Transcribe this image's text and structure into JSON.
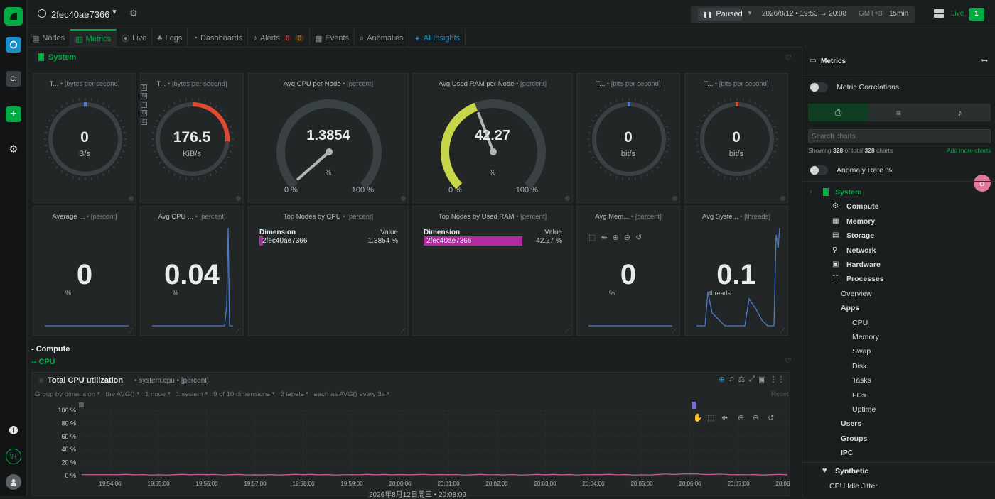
{
  "rail": {
    "logo": "leaf-logo",
    "items": [
      "chat-icon",
      "space-icon",
      "plus-icon",
      "gear-icon"
    ],
    "bottom": [
      "info-icon",
      "9+",
      "avatar"
    ],
    "space_label": "C:"
  },
  "topbar": {
    "node_name": "2fec40ae7366",
    "state": "Paused",
    "time_range": "2026/8/12 • 19:53 → 20:08",
    "tz": "GMT+8",
    "duration": "15min",
    "live_label": "Live",
    "live_count": "1"
  },
  "tabs": [
    {
      "label": "Nodes",
      "icon": "nodes-icon"
    },
    {
      "label": "Metrics",
      "icon": "metrics-icon",
      "active": true
    },
    {
      "label": "Live",
      "icon": "live-icon"
    },
    {
      "label": "Logs",
      "icon": "logs-icon"
    },
    {
      "label": "Dashboards",
      "icon": "dashboards-icon"
    },
    {
      "label": "Alerts",
      "icon": "alerts-icon",
      "badges": [
        "0",
        "0"
      ]
    },
    {
      "label": "Events",
      "icon": "events-icon"
    },
    {
      "label": "Anomalies",
      "icon": "anomalies-icon"
    },
    {
      "label": "AI Insights",
      "icon": "ai-icon"
    }
  ],
  "section": {
    "title": "System",
    "compute": "- Compute",
    "cpu": "-- CPU"
  },
  "gauges": [
    {
      "title": "T...",
      "unit": "• [bytes per second]",
      "value": "0",
      "units_label": "B/s"
    },
    {
      "title": "T...",
      "unit": "• [bytes per second]",
      "value": "176.5",
      "units_label": "KiB/s"
    },
    {
      "title": "Avg CPU per Node",
      "unit": "• [percent]",
      "value": "1.3854",
      "units_label": "%",
      "min": "0 %",
      "max": "100 %"
    },
    {
      "title": "Avg Used RAM per Node",
      "unit": "• [percent]",
      "value": "42.27",
      "units_label": "%",
      "min": "0 %",
      "max": "100 %"
    },
    {
      "title": "T...",
      "unit": "• [bits per second]",
      "value": "0",
      "units_label": "bit/s"
    },
    {
      "title": "T...",
      "unit": "• [bits per second]",
      "value": "0",
      "units_label": "bit/s"
    }
  ],
  "gauge_side_letters": [
    "Σ",
    "N",
    "T",
    "D",
    "E"
  ],
  "row2": [
    {
      "title": "Average ...",
      "unit": "• [percent]",
      "value": "0",
      "units_label": "%"
    },
    {
      "title": "Avg CPU ...",
      "unit": "• [percent]",
      "value": "0.04",
      "units_label": "%"
    },
    {
      "title": "Top Nodes by CPU",
      "unit": "• [percent]",
      "col1": "Dimension",
      "col2": "Value",
      "node": "2fec40ae7366",
      "value": "1.3854",
      "value_unit": "%"
    },
    {
      "title": "Top Nodes by Used RAM",
      "unit": "• [percent]",
      "col1": "Dimension",
      "col2": "Value",
      "node": "2fec40ae7366",
      "value": "42.27",
      "value_unit": "%"
    },
    {
      "title": "Avg Mem...",
      "unit": "• [percent]",
      "value": "0",
      "units_label": "%"
    },
    {
      "title": "Avg Syste...",
      "unit": "• [threads]",
      "value": "0.1",
      "units_label": "threads"
    }
  ],
  "cpu_chart": {
    "title": "Total CPU utilization",
    "context": "• system.cpu • [percent]",
    "controls": [
      "Group by dimension",
      "the AVG()",
      "1 node",
      "1 system",
      "9 of 10 dimensions",
      "2 labels",
      "each as AVG() every 3s"
    ],
    "reset": "Reset",
    "timestamp": "2026年8月12日周三 • 20:08:09"
  },
  "chart_data": {
    "type": "line",
    "title": "Total CPU utilization",
    "ylabel": "",
    "ylim": [
      0,
      100
    ],
    "y_ticks": [
      "100 %",
      "80 %",
      "60 %",
      "40 %",
      "20 %",
      "0 %"
    ],
    "categories": [
      "19:54:00",
      "19:55:00",
      "19:56:00",
      "19:57:00",
      "19:58:00",
      "19:59:00",
      "20:00:00",
      "20:01:00",
      "20:02:00",
      "20:03:00",
      "20:04:00",
      "20:05:00",
      "20:06:00",
      "20:07:00",
      "20:08:00"
    ],
    "series": [
      {
        "values": [
          1.4,
          1.3,
          1.5,
          1.2,
          1.4,
          1.3,
          1.6,
          1.3,
          1.4,
          1.2,
          1.5,
          1.3,
          2.4,
          1.4,
          1.3
        ]
      }
    ]
  },
  "sidebar": {
    "title": "Metrics",
    "correlations": "Metric Correlations",
    "search_placeholder": "Search charts",
    "showing_pre": "Showing",
    "showing_n": "328",
    "showing_mid": "of total",
    "showing_total": "328",
    "showing_post": "charts",
    "add_more": "Add more charts",
    "anomaly": "Anomaly Rate %",
    "tree": [
      {
        "label": "System",
        "level": 0,
        "bold": true,
        "green": true
      },
      {
        "label": "Compute",
        "level": 1,
        "bold": true,
        "icon": "cpu-icon"
      },
      {
        "label": "Memory",
        "level": 1,
        "bold": true,
        "icon": "memory-icon"
      },
      {
        "label": "Storage",
        "level": 1,
        "bold": true,
        "icon": "storage-icon"
      },
      {
        "label": "Network",
        "level": 1,
        "bold": true,
        "icon": "network-icon"
      },
      {
        "label": "Hardware",
        "level": 1,
        "bold": true,
        "icon": "hardware-icon"
      },
      {
        "label": "Processes",
        "level": 1,
        "bold": true,
        "icon": "processes-icon"
      },
      {
        "label": "Overview",
        "level": 2
      },
      {
        "label": "Apps",
        "level": 2,
        "bold": true
      },
      {
        "label": "CPU",
        "level": 3
      },
      {
        "label": "Memory",
        "level": 3
      },
      {
        "label": "Swap",
        "level": 3
      },
      {
        "label": "Disk",
        "level": 3
      },
      {
        "label": "Tasks",
        "level": 3
      },
      {
        "label": "FDs",
        "level": 3
      },
      {
        "label": "Uptime",
        "level": 3
      },
      {
        "label": "Users",
        "level": 2,
        "bold": true
      },
      {
        "label": "Groups",
        "level": 2,
        "bold": true
      },
      {
        "label": "IPC",
        "level": 2,
        "bold": true
      }
    ],
    "synthetic": "Synthetic",
    "idle_jitter": "CPU Idle Jitter"
  }
}
